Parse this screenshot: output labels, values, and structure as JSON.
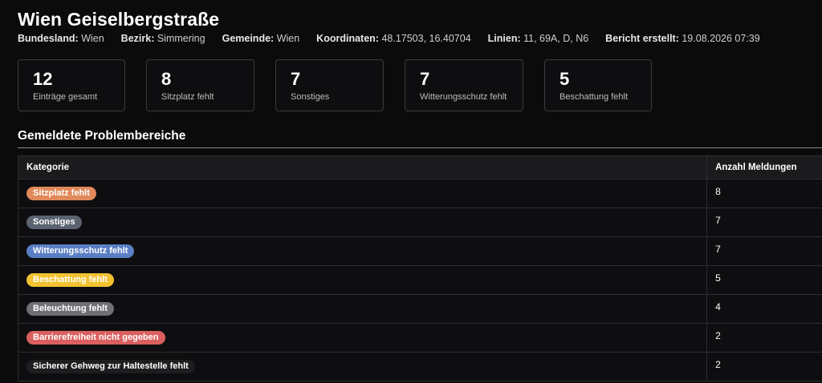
{
  "header": {
    "title": "Wien Geiselbergstraße",
    "meta": [
      {
        "label": "Bundesland:",
        "value": "Wien"
      },
      {
        "label": "Bezirk:",
        "value": "Simmering"
      },
      {
        "label": "Gemeinde:",
        "value": "Wien"
      },
      {
        "label": "Koordinaten:",
        "value": "48.17503, 16.40704"
      },
      {
        "label": "Linien:",
        "value": "11, 69A, D, N6"
      },
      {
        "label": "Bericht erstellt:",
        "value": "19.08.2026 07:39"
      }
    ]
  },
  "cards": [
    {
      "value": "12",
      "label": "Einträge gesamt"
    },
    {
      "value": "8",
      "label": "Sitzplatz fehlt"
    },
    {
      "value": "7",
      "label": "Sonstiges"
    },
    {
      "value": "7",
      "label": "Witterungsschutz fehlt"
    },
    {
      "value": "5",
      "label": "Beschattung fehlt"
    }
  ],
  "section": {
    "title": "Gemeldete Problembereiche"
  },
  "table": {
    "headers": [
      "Kategorie",
      "Anzahl Meldungen"
    ],
    "rows": [
      {
        "category": "Sitzplatz fehlt",
        "count": "8",
        "color": "#e0895a",
        "text_color": "#ffffff"
      },
      {
        "category": "Sonstiges",
        "count": "7",
        "color": "#5b6270",
        "text_color": "#ffffff"
      },
      {
        "category": "Witterungsschutz fehlt",
        "count": "7",
        "color": "#5a7fc4",
        "text_color": "#ffffff"
      },
      {
        "category": "Beschattung fehlt",
        "count": "5",
        "color": "#f2c230",
        "text_color": "#ffffff"
      },
      {
        "category": "Beleuchtung fehlt",
        "count": "4",
        "color": "#6e7076",
        "text_color": "#ffffff"
      },
      {
        "category": "Barrierefreiheit nicht gegeben",
        "count": "2",
        "color": "#d9605f",
        "text_color": "#ffffff"
      },
      {
        "category": "Sicherer Gehweg zur Haltestelle fehlt",
        "count": "2",
        "color": "#1e1e21",
        "text_color": "#ffffff"
      }
    ]
  }
}
